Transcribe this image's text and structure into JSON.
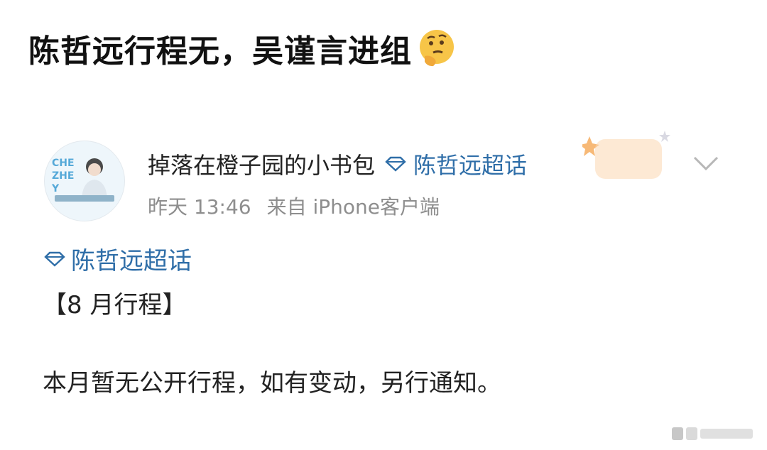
{
  "headline": {
    "text": "陈哲远行程无，吴谨言进组"
  },
  "post": {
    "username": "掉落在橙子园的小书包",
    "topic_inline": "陈哲远超话",
    "time": "昨天 13:46",
    "source": "来自 iPhone客户端",
    "topic_line": "陈哲远超话",
    "title": "【8 月行程】",
    "content": "本月暂无公开行程，如有变动，另行通知。"
  },
  "icons": [
    "thinking-face-emoji-icon",
    "diamond-icon",
    "chevron-down-icon"
  ],
  "colors": {
    "link": "#2f6ea8",
    "meta": "#8e8e8e",
    "text": "#222222"
  }
}
